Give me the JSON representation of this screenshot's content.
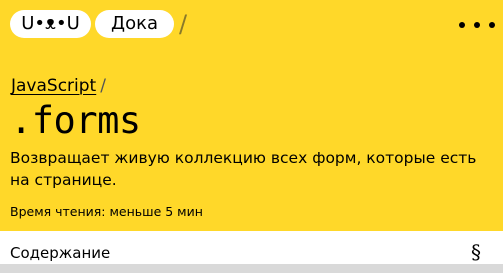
{
  "header": {
    "logo_text": "U•ᴥ•U",
    "site_name": "Дока",
    "separator": "/",
    "menu_icon": "more-horizontal-icon"
  },
  "breadcrumb": {
    "section": "JavaScript",
    "separator": "/"
  },
  "article": {
    "title": ".forms",
    "description": "Возвращает живую коллекцию всех форм, которые есть на странице.",
    "reading_time": "Время чтения: меньше 5 мин"
  },
  "toc": {
    "label": "Содержание",
    "icon_glyph": "§",
    "icon": "section-sign-icon"
  },
  "colors": {
    "background": "#ffd829",
    "pill": "#ffffff",
    "text": "#000000",
    "toc_background": "#ffffff",
    "bottom_strip": "#d9d9d9"
  }
}
